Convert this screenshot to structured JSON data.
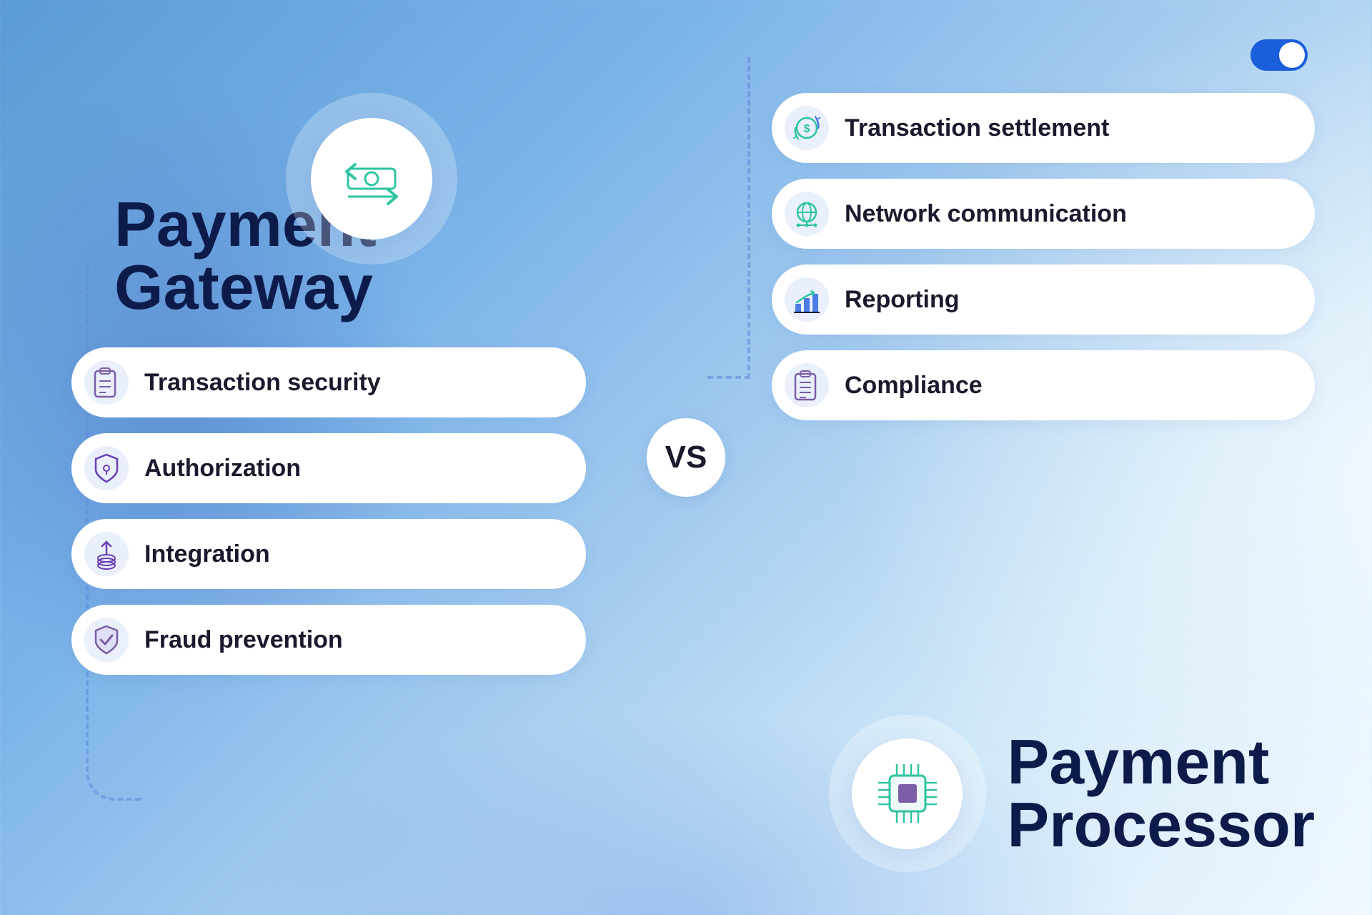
{
  "toggle": {
    "label": "toggle-on"
  },
  "left": {
    "title_line1": "Payment",
    "title_line2": "Gateway",
    "features": [
      {
        "label": "Transaction security",
        "icon": "clipboard-lock"
      },
      {
        "label": "Authorization",
        "icon": "shield-lock"
      },
      {
        "label": "Integration",
        "icon": "coins-stack"
      },
      {
        "label": "Fraud prevention",
        "icon": "shield-check"
      }
    ]
  },
  "vs": "VS",
  "right": {
    "features": [
      {
        "label": "Transaction settlement",
        "icon": "money-cycle"
      },
      {
        "label": "Network communication",
        "icon": "globe-network"
      },
      {
        "label": "Reporting",
        "icon": "bar-chart"
      },
      {
        "label": "Compliance",
        "icon": "clipboard-list"
      }
    ],
    "title_line1": "Payment",
    "title_line2": "Processor"
  }
}
